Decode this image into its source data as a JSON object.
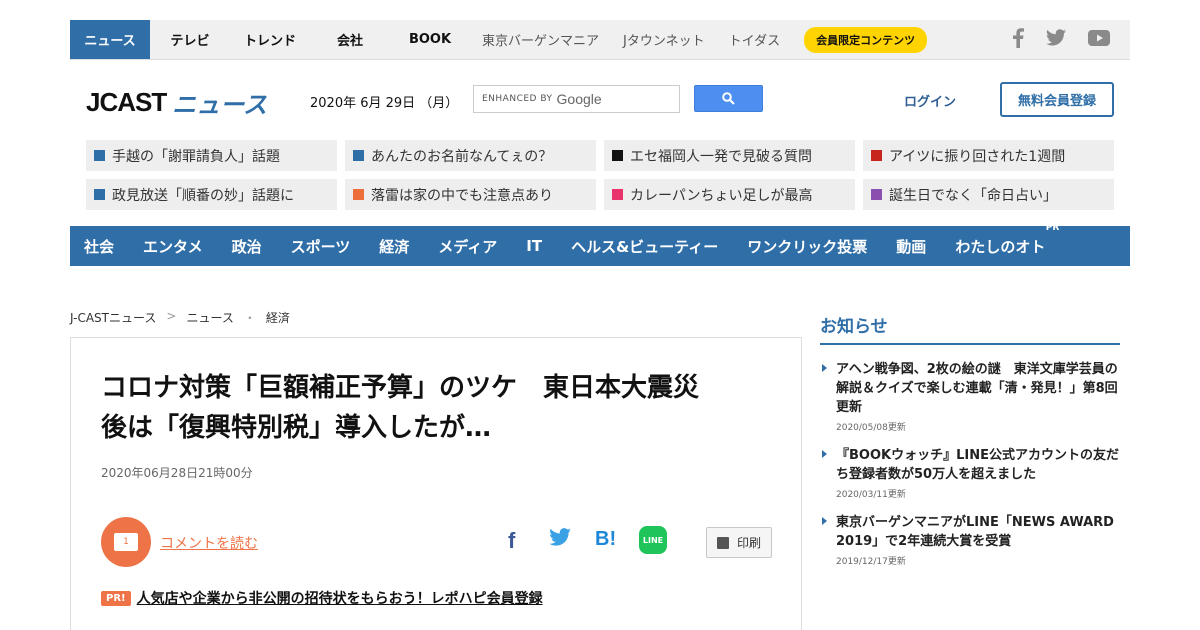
{
  "topbar": {
    "tabs": [
      "ニュース",
      "テレビ",
      "トレンド",
      "会社",
      "BOOK"
    ],
    "partners": [
      "東京バーゲンマニア",
      "Jタウンネット",
      "トイダス"
    ],
    "member_pill": "会員限定コンテンツ",
    "social_icons": [
      "facebook-icon",
      "twitter-icon",
      "youtube-icon"
    ]
  },
  "header": {
    "logo_jcast": "JCAST",
    "logo_news": "ニュース",
    "date": "2020年 6月 29日 （月）",
    "search_enhanced": "ENHANCED BY",
    "search_google": "Google",
    "login": "ログイン",
    "register": "無料会員登録"
  },
  "trending": [
    {
      "text": "手越の「謝罪請負人」話題",
      "color": "#2f6ea7"
    },
    {
      "text": "あんたのお名前なんてぇの？",
      "color": "#2f6ea7"
    },
    {
      "text": "エセ福岡人一発で見破る質問",
      "color": "#111111"
    },
    {
      "text": "アイツに振り回された1週間",
      "color": "#c8241e"
    },
    {
      "text": "政見放送「順番の妙」話題に",
      "color": "#2f6ea7"
    },
    {
      "text": "落雷は家の中でも注意点あり",
      "color": "#ee6e3a"
    },
    {
      "text": "カレーパンちょい足しが最高",
      "color": "#e8336d"
    },
    {
      "text": "誕生日でなく「命日占い」",
      "color": "#8b4fb0"
    }
  ],
  "nav": {
    "items": [
      "社会",
      "エンタメ",
      "政治",
      "スポーツ",
      "経済",
      "メディア",
      "IT",
      "ヘルス&ビューティー",
      "ワンクリック投票",
      "動画",
      "わたしのオト"
    ],
    "pr_tag": "PR"
  },
  "breadcrumb": [
    "J-CASTニュース",
    "ニュース",
    "経済"
  ],
  "article": {
    "headline_1": "コロナ対策「巨額補正予算」のツケ　東日本大震災",
    "headline_2": "後は「復興特別税」導入したが…",
    "published": "2020年06月28日21時00分",
    "comment_count": "1",
    "comment_link": "コメントを読む",
    "share_fb": "f",
    "share_hb": "B!",
    "share_line": "LINE",
    "print": "印刷",
    "pr_badge": "PR!",
    "pr_text": "人気店や企業から非公開の招待状をもらおう！レポハピ会員登録"
  },
  "sidebar": {
    "title": "お知らせ",
    "items": [
      {
        "text": "アヘン戦争図、2枚の絵の謎　東洋文庫学芸員の解説＆クイズで楽しむ連載「清・発見！」第8回更新",
        "date": "2020/05/08更新"
      },
      {
        "text": "『BOOKウォッチ』LINE公式アカウントの友だち登録者数が50万人を超えました",
        "date": "2020/03/11更新"
      },
      {
        "text": "東京バーゲンマニアがLINE「NEWS AWARD 2019」で2年連続大賞を受賞",
        "date": "2019/12/17更新"
      }
    ]
  }
}
